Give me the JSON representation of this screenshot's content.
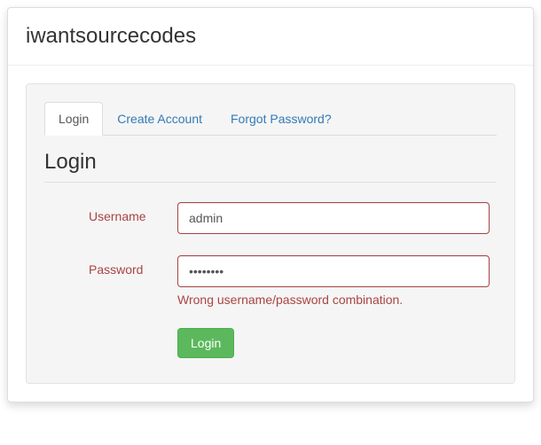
{
  "header": {
    "title": "iwantsourcecodes"
  },
  "tabs": [
    {
      "label": "Login",
      "active": true
    },
    {
      "label": "Create Account",
      "active": false
    },
    {
      "label": "Forgot Password?",
      "active": false
    }
  ],
  "form": {
    "title": "Login",
    "username": {
      "label": "Username",
      "value": "admin",
      "has_error": true
    },
    "password": {
      "label": "Password",
      "value": "••••••••",
      "has_error": true,
      "error_text": "Wrong username/password combination."
    },
    "submit_label": "Login"
  }
}
